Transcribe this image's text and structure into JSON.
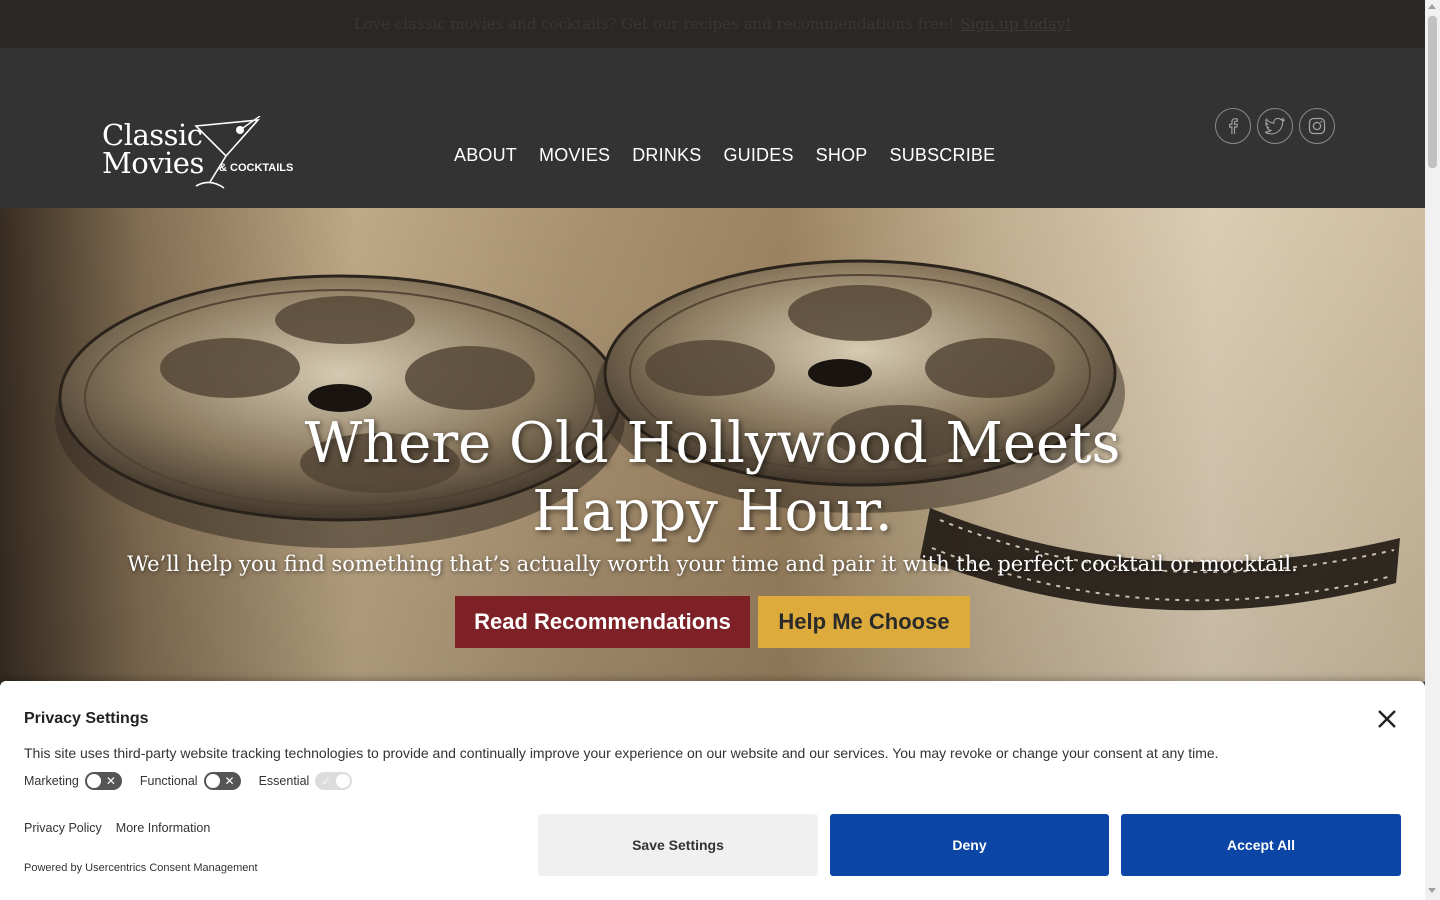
{
  "announcement": {
    "text": "Love classic movies and cocktails? Get our recipes and recommendations free!",
    "link": "Sign up today!"
  },
  "logo": {
    "line1": "Classic",
    "line2": "Movies",
    "line3": "& COCKTAILS"
  },
  "nav": [
    "ABOUT",
    "MOVIES",
    "DRINKS",
    "GUIDES",
    "SHOP",
    "SUBSCRIBE"
  ],
  "social": [
    "facebook-icon",
    "twitter-icon",
    "instagram-icon"
  ],
  "hero": {
    "headline_line1": "Where Old Hollywood Meets",
    "headline_line2": "Happy Hour.",
    "subtitle": "We’ll help you find something that’s actually worth your time and pair it with the perfect cocktail or mocktail.",
    "primary_button": "Read Recommendations",
    "secondary_button": "Help Me Choose"
  },
  "privacy": {
    "title": "Privacy Settings",
    "description": "This site uses third-party website tracking technologies to provide and continually improve your experience on our website and our services. You may revoke or change your consent at any time.",
    "toggles": [
      {
        "label": "Marketing",
        "state": "off"
      },
      {
        "label": "Functional",
        "state": "off"
      },
      {
        "label": "Essential",
        "state": "on"
      }
    ],
    "links": [
      "Privacy Policy",
      "More Information"
    ],
    "powered_by": "Powered by Usercentrics Consent Management",
    "buttons": {
      "save": "Save Settings",
      "deny": "Deny",
      "accept": "Accept All"
    }
  },
  "colors": {
    "header_bg": "#333333",
    "read_button": "#7e2126",
    "help_button": "#dcab3c",
    "consent_blue": "#0b45a5"
  }
}
